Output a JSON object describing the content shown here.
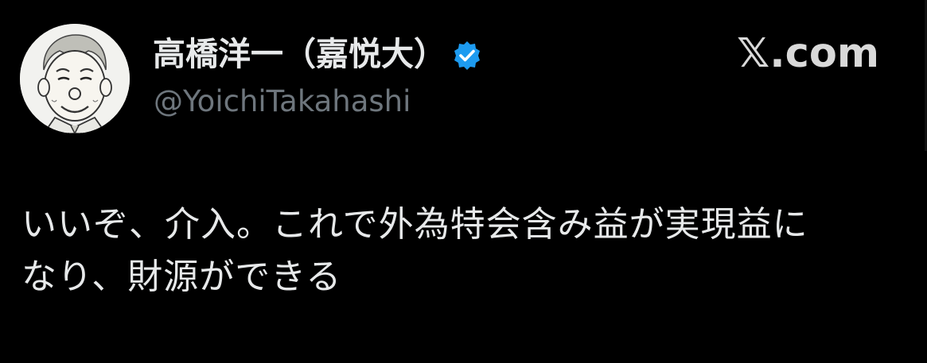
{
  "tweet": {
    "display_name": "高橋洋一（嘉悦大）",
    "handle": "@YoichiTakahashi",
    "text": "いいぞ、介入。これで外為特会含み益が実現益に\nなり、財源ができる",
    "verified": true
  },
  "brand": {
    "label": "𝕏.com"
  },
  "colors": {
    "background": "#000000",
    "text": "#e7e9ea",
    "secondary_text": "#6e767d",
    "verified_blue": "#1d9bf0"
  },
  "icons": {
    "verified": "verified-badge-icon",
    "avatar": "cartoon-portrait"
  }
}
